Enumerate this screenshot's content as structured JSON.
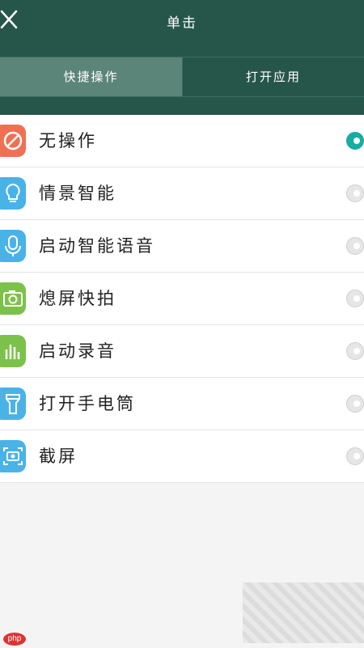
{
  "header": {
    "title": "单击",
    "close_icon": "close-icon"
  },
  "tabs": [
    {
      "label": "快捷操作",
      "active": true
    },
    {
      "label": "打开应用",
      "active": false
    }
  ],
  "options": [
    {
      "label": "无操作",
      "icon": "no-action-icon",
      "icon_color": "#f07053",
      "selected": true
    },
    {
      "label": "情景智能",
      "icon": "lightbulb-icon",
      "icon_color": "#49b3e8",
      "selected": false
    },
    {
      "label": "启动智能语音",
      "icon": "microphone-icon",
      "icon_color": "#49b3e8",
      "selected": false
    },
    {
      "label": "熄屏快拍",
      "icon": "camera-icon",
      "icon_color": "#7cc24a",
      "selected": false
    },
    {
      "label": "启动录音",
      "icon": "audio-bars-icon",
      "icon_color": "#7cc24a",
      "selected": false
    },
    {
      "label": "打开手电筒",
      "icon": "flashlight-icon",
      "icon_color": "#49b3e8",
      "selected": false
    },
    {
      "label": "截屏",
      "icon": "screenshot-icon",
      "icon_color": "#49b3e8",
      "selected": false
    }
  ],
  "colors": {
    "header_bg": "#26564a",
    "active_tab_bg": "#5b8579",
    "radio_selected": "#19aca2"
  },
  "watermark": {
    "logo": "php"
  }
}
